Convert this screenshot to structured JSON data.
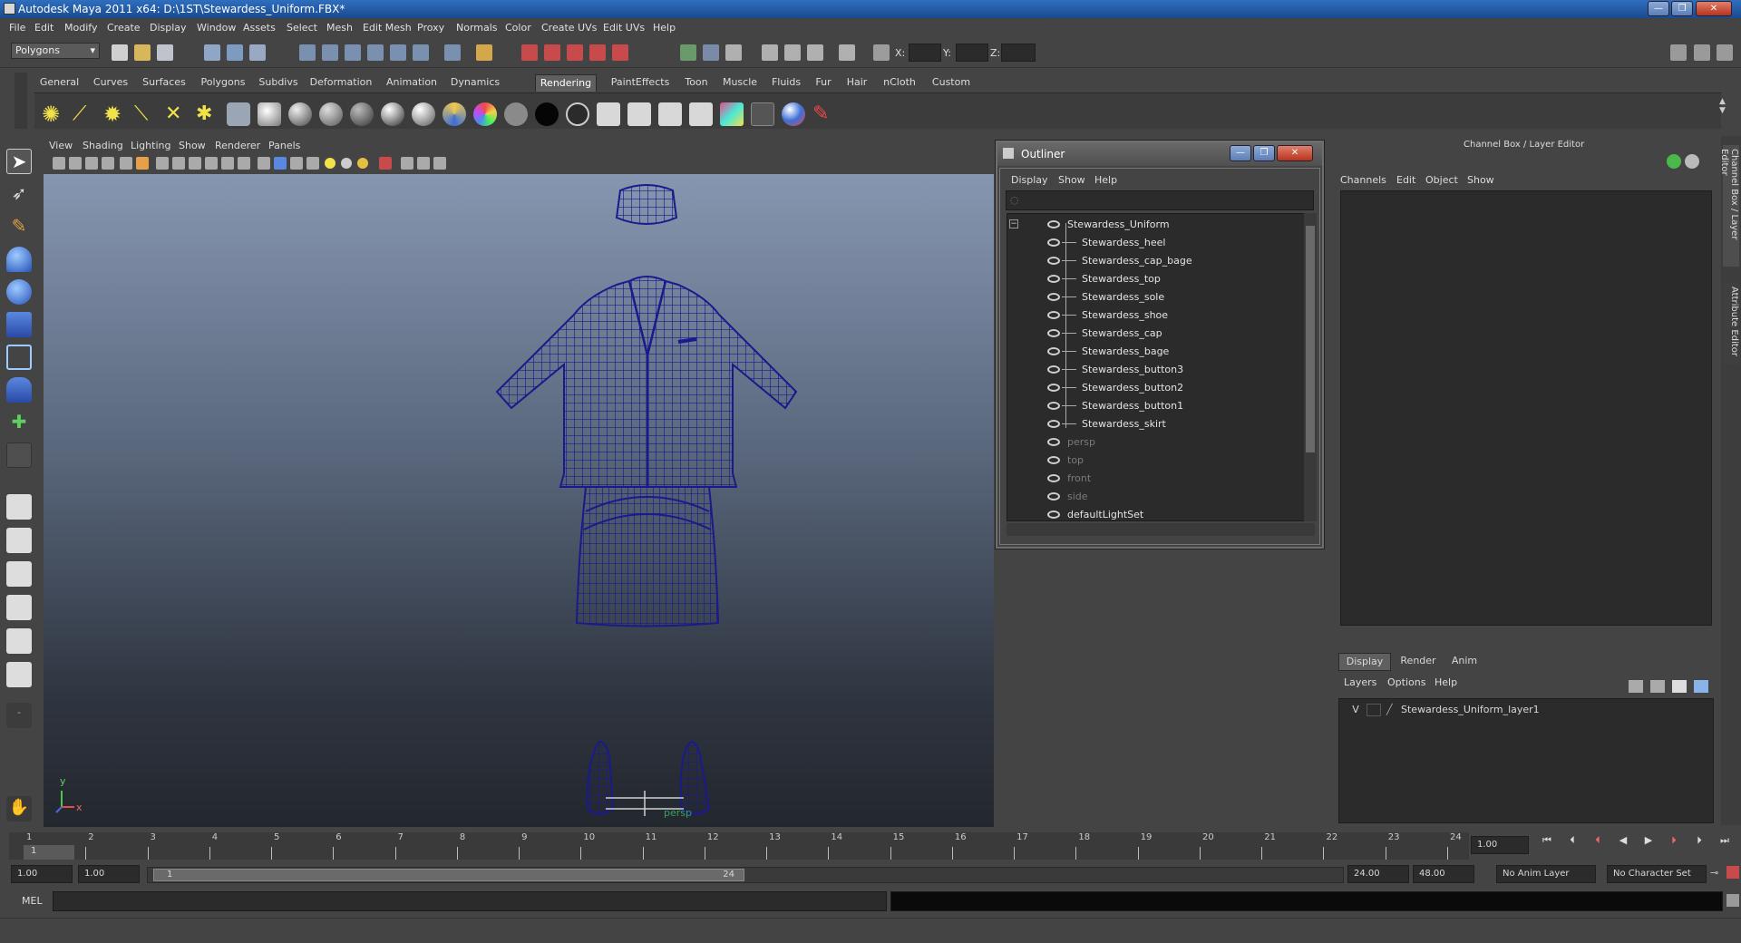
{
  "window": {
    "title": "Autodesk Maya 2011 x64: D:\\1ST\\Stewardess_Uniform.FBX*",
    "buttons": [
      "—",
      "❐",
      "✕"
    ]
  },
  "menubar": [
    "File",
    "Edit",
    "Modify",
    "Create",
    "Display",
    "Window",
    "Assets",
    "Select",
    "Mesh",
    "Edit Mesh",
    "Proxy",
    "Normals",
    "Color",
    "Create UVs",
    "Edit UVs",
    "Help"
  ],
  "statusline": {
    "mode_dropdown": "Polygons",
    "coord_labels": [
      "X:",
      "Y:",
      "Z:"
    ]
  },
  "shelf": {
    "tabs": [
      "General",
      "Curves",
      "Surfaces",
      "Polygons",
      "Subdivs",
      "Deformation",
      "Animation",
      "Dynamics",
      "Rendering",
      "PaintEffects",
      "Toon",
      "Muscle",
      "Fluids",
      "Fur",
      "Hair",
      "nCloth",
      "Custom"
    ],
    "active_tab": "Rendering"
  },
  "viewport": {
    "menu": [
      "View",
      "Shading",
      "Lighting",
      "Show",
      "Renderer",
      "Panels"
    ],
    "camera_label": "persp",
    "axis_y": "y",
    "axis_x": "x",
    "wire_color": "#1a1a8c"
  },
  "outliner": {
    "title": "Outliner",
    "menu": [
      "Display",
      "Show",
      "Help"
    ],
    "items": [
      {
        "label": "Stewardess_Uniform",
        "dim": false,
        "child": false
      },
      {
        "label": "Stewardess_heel",
        "dim": false,
        "child": true
      },
      {
        "label": "Stewardess_cap_bage",
        "dim": false,
        "child": true
      },
      {
        "label": "Stewardess_top",
        "dim": false,
        "child": true
      },
      {
        "label": "Stewardess_sole",
        "dim": false,
        "child": true
      },
      {
        "label": "Stewardess_shoe",
        "dim": false,
        "child": true
      },
      {
        "label": "Stewardess_cap",
        "dim": false,
        "child": true
      },
      {
        "label": "Stewardess_bage",
        "dim": false,
        "child": true
      },
      {
        "label": "Stewardess_button3",
        "dim": false,
        "child": true
      },
      {
        "label": "Stewardess_button2",
        "dim": false,
        "child": true
      },
      {
        "label": "Stewardess_button1",
        "dim": false,
        "child": true
      },
      {
        "label": "Stewardess_skirt",
        "dim": false,
        "child": true
      },
      {
        "label": "persp",
        "dim": true,
        "child": false
      },
      {
        "label": "top",
        "dim": true,
        "child": false
      },
      {
        "label": "front",
        "dim": true,
        "child": false
      },
      {
        "label": "side",
        "dim": true,
        "child": false
      },
      {
        "label": "defaultLightSet",
        "dim": false,
        "child": false
      }
    ]
  },
  "channelbox": {
    "title": "Channel Box / Layer Editor",
    "menu": [
      "Channels",
      "Edit",
      "Object",
      "Show"
    ],
    "layer_tabs": [
      "Display",
      "Render",
      "Anim"
    ],
    "layer_menu": [
      "Layers",
      "Options",
      "Help"
    ],
    "layer": {
      "visible": "V",
      "name": "Stewardess_Uniform_layer1"
    },
    "side_tabs": [
      "Channel Box / Layer Editor",
      "Attribute Editor"
    ]
  },
  "timeline": {
    "ticks": [
      "1",
      "2",
      "3",
      "4",
      "5",
      "6",
      "7",
      "8",
      "9",
      "10",
      "11",
      "12",
      "13",
      "14",
      "15",
      "16",
      "17",
      "18",
      "19",
      "20",
      "21",
      "22",
      "23",
      "24"
    ],
    "current_frame_marker": "1",
    "current_time": "1.00",
    "start_time": "1.00",
    "playback_start": "1.00",
    "range_start_label": "1",
    "range_end_label": "24",
    "playback_end": "24.00",
    "end_time": "48.00",
    "anim_layer": "No Anim Layer",
    "character_set": "No Character Set"
  },
  "commandline": {
    "label": "MEL"
  }
}
